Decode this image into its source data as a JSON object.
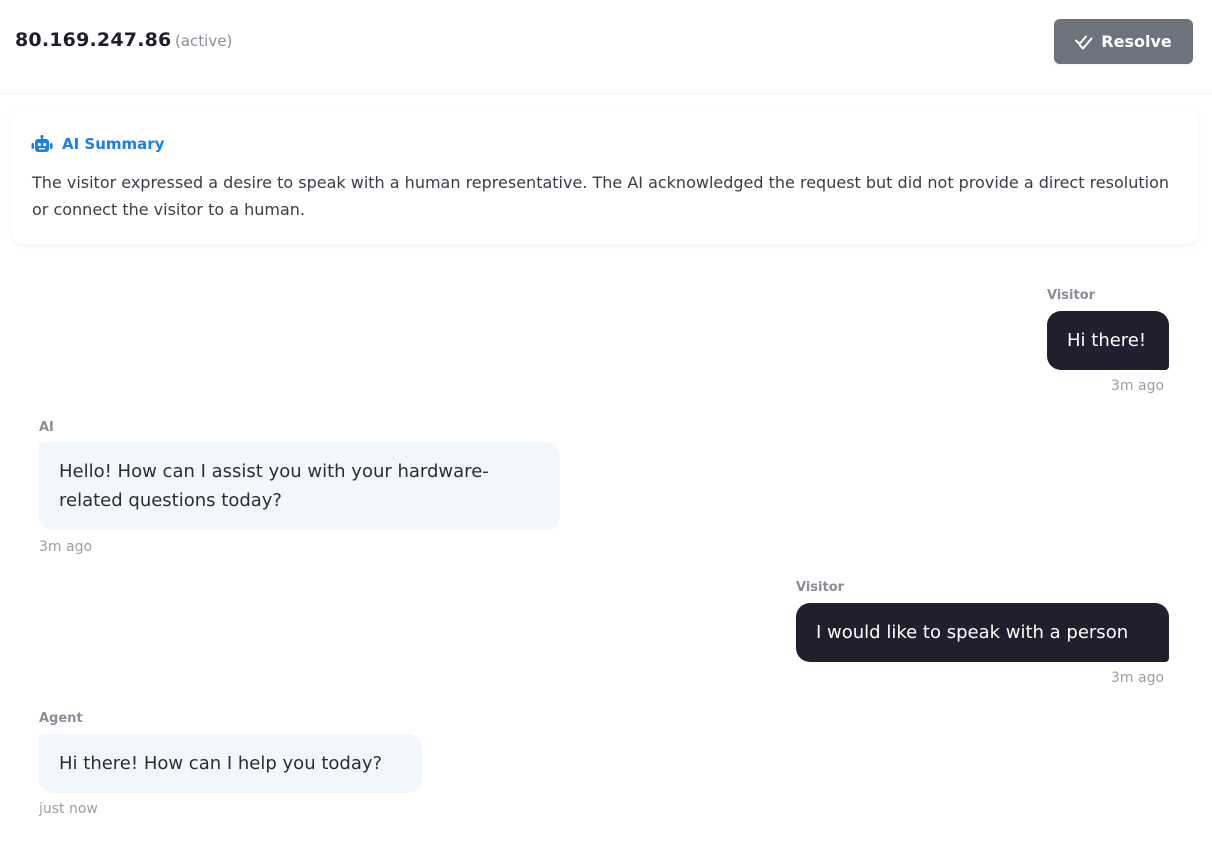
{
  "header": {
    "ip": "80.169.247.86",
    "status": "(active)",
    "resolve_label": "Resolve"
  },
  "summary": {
    "title": "AI Summary",
    "text": "The visitor expressed a desire to speak with a human representative. The AI acknowledged the request but did not provide a direct resolution or connect the visitor to a human."
  },
  "messages": [
    {
      "role": "Visitor",
      "text": "Hi there!",
      "time": "3m ago"
    },
    {
      "role": "AI",
      "text": "Hello! How can I assist you with your hardware-related questions today?",
      "time": "3m ago"
    },
    {
      "role": "Visitor",
      "text": "I would like to speak with a person",
      "time": "3m ago"
    },
    {
      "role": "Agent",
      "text": "Hi there! How can I help you today?",
      "time": "just now"
    }
  ],
  "colors": {
    "accent": "#1a7fe6",
    "resolve_bg": "#6c737d",
    "visitor_bubble": "#1f1f2e",
    "bot_bubble": "#f2f7fd"
  },
  "icons": {
    "resolve": "double-check-icon",
    "summary": "robot-icon"
  }
}
